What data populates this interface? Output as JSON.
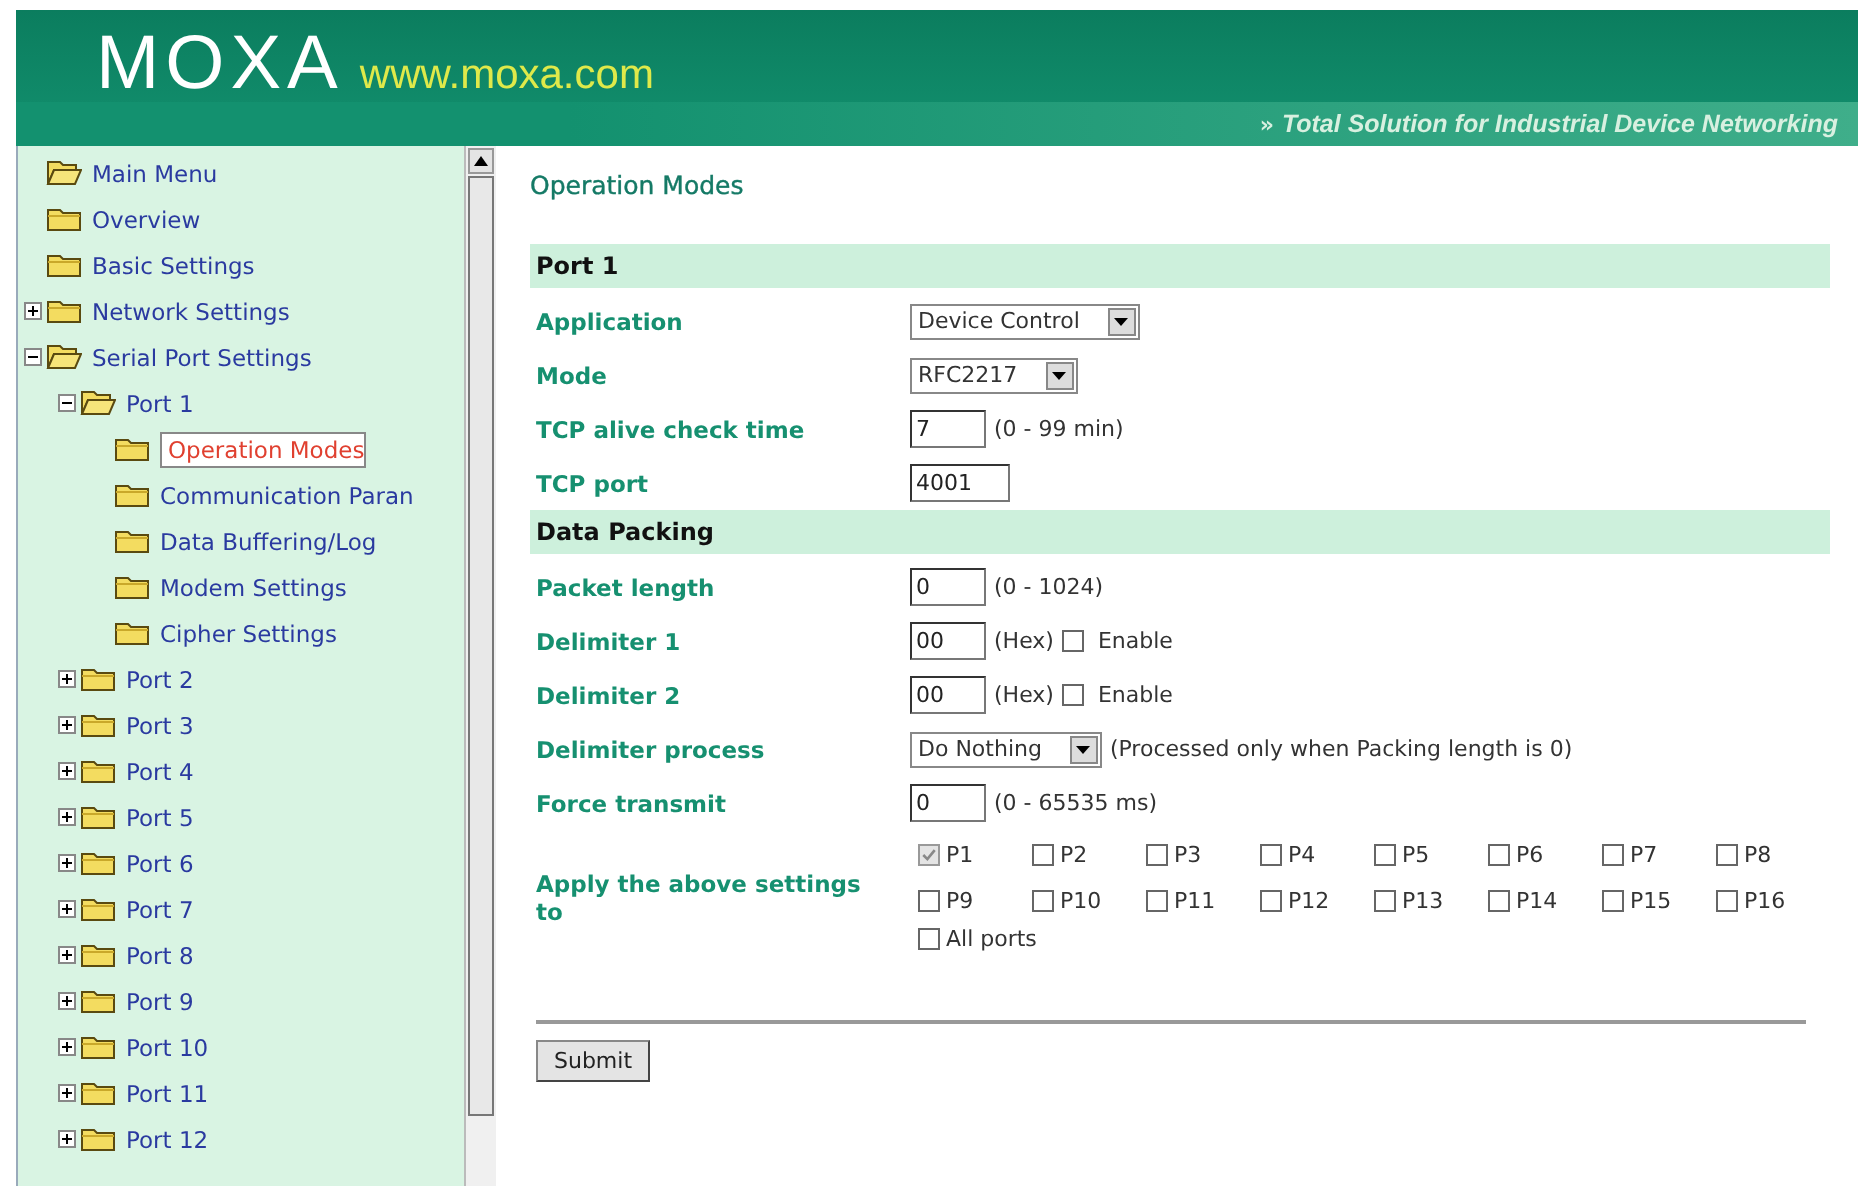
{
  "header": {
    "logo": "MOXA",
    "site": "www.moxa.com",
    "tagline_mark": "»",
    "tagline": "Total Solution for Industrial Device Networking"
  },
  "sidebar": {
    "tree": [
      {
        "label": "Main Menu",
        "expanded": true,
        "selected": false,
        "children": [
          {
            "label": "Overview",
            "selected": false
          },
          {
            "label": "Basic Settings",
            "selected": false
          },
          {
            "label": "Network Settings",
            "expanded": false,
            "selected": false
          },
          {
            "label": "Serial Port Settings",
            "expanded": true,
            "selected": false,
            "children": [
              {
                "label": "Port 1",
                "expanded": true,
                "selected": false,
                "children": [
                  {
                    "label": "Operation Modes",
                    "selected": true
                  },
                  {
                    "label": "Communication Paran",
                    "selected": false
                  },
                  {
                    "label": "Data Buffering/Log",
                    "selected": false
                  },
                  {
                    "label": "Modem Settings",
                    "selected": false
                  },
                  {
                    "label": "Cipher Settings",
                    "selected": false
                  }
                ]
              },
              {
                "label": "Port 2",
                "expanded": false,
                "selected": false
              },
              {
                "label": "Port 3",
                "expanded": false,
                "selected": false
              },
              {
                "label": "Port 4",
                "expanded": false,
                "selected": false
              },
              {
                "label": "Port 5",
                "expanded": false,
                "selected": false
              },
              {
                "label": "Port 6",
                "expanded": false,
                "selected": false
              },
              {
                "label": "Port 7",
                "expanded": false,
                "selected": false
              },
              {
                "label": "Port 8",
                "expanded": false,
                "selected": false
              },
              {
                "label": "Port 9",
                "expanded": false,
                "selected": false
              },
              {
                "label": "Port 10",
                "expanded": false,
                "selected": false
              },
              {
                "label": "Port 11",
                "expanded": false,
                "selected": false
              },
              {
                "label": "Port 12",
                "expanded": false,
                "selected": false
              }
            ]
          }
        ]
      }
    ]
  },
  "page": {
    "title": "Operation Modes",
    "sections": [
      {
        "title": "Port 1",
        "rows": [
          {
            "kind": "select",
            "label": "Application",
            "value": "Device Control"
          },
          {
            "kind": "select",
            "label": "Mode",
            "value": "RFC2217"
          },
          {
            "kind": "input",
            "label": "TCP alive check time",
            "value": "7",
            "hint": "(0 - 99 min)"
          },
          {
            "kind": "input",
            "label": "TCP port",
            "value": "4001"
          }
        ]
      },
      {
        "title": "Data Packing",
        "rows": [
          {
            "kind": "input",
            "label": "Packet length",
            "value": "0",
            "hint": "(0 - 1024)"
          },
          {
            "kind": "input",
            "label": "Delimiter 1",
            "value": "00",
            "hint": "(Hex)",
            "enable": {
              "label": "Enable",
              "checked": false
            }
          },
          {
            "kind": "input",
            "label": "Delimiter 2",
            "value": "00",
            "hint": "(Hex)",
            "enable": {
              "label": "Enable",
              "checked": false
            }
          },
          {
            "kind": "select",
            "label": "Delimiter process",
            "value": "Do Nothing",
            "hint": "(Processed only when Packing length is 0)"
          },
          {
            "kind": "input",
            "label": "Force transmit",
            "value": "0",
            "hint": "(0 - 65535 ms)"
          },
          {
            "kind": "ports",
            "label": "Apply the above settings to",
            "ports": [
              {
                "label": "P1",
                "checked": true,
                "disabled": true
              },
              {
                "label": "P2",
                "checked": false,
                "disabled": false
              },
              {
                "label": "P3",
                "checked": false,
                "disabled": false
              },
              {
                "label": "P4",
                "checked": false,
                "disabled": false
              },
              {
                "label": "P5",
                "checked": false,
                "disabled": false
              },
              {
                "label": "P6",
                "checked": false,
                "disabled": false
              },
              {
                "label": "P7",
                "checked": false,
                "disabled": false
              },
              {
                "label": "P8",
                "checked": false,
                "disabled": false
              },
              {
                "label": "P9",
                "checked": false,
                "disabled": false
              },
              {
                "label": "P10",
                "checked": false,
                "disabled": false
              },
              {
                "label": "P11",
                "checked": false,
                "disabled": false
              },
              {
                "label": "P12",
                "checked": false,
                "disabled": false
              },
              {
                "label": "P13",
                "checked": false,
                "disabled": false
              },
              {
                "label": "P14",
                "checked": false,
                "disabled": false
              },
              {
                "label": "P15",
                "checked": false,
                "disabled": false
              },
              {
                "label": "P16",
                "checked": false,
                "disabled": false
              }
            ],
            "all_ports": {
              "label": "All ports",
              "checked": false
            }
          }
        ]
      }
    ],
    "submit": "Submit"
  }
}
